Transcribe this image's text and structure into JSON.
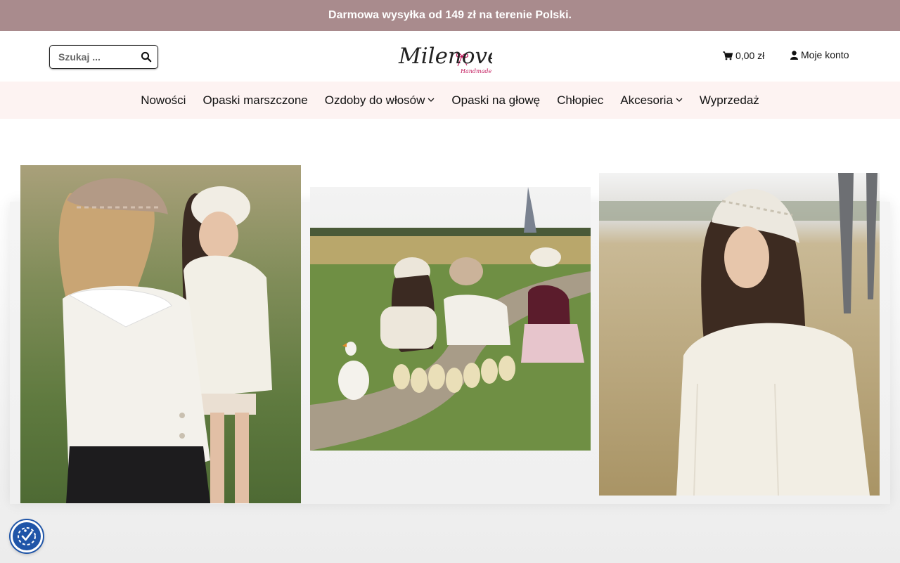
{
  "announcement": {
    "text": "Darmowa wysyłka od 149 zł na terenie Polski."
  },
  "header": {
    "search": {
      "placeholder": "Szukaj ...",
      "value": ""
    },
    "logo": {
      "name": "Milenove",
      "tagline": "Handmade"
    },
    "cart": {
      "amount": "0,00 zł",
      "icon": "cart-icon"
    },
    "account": {
      "label": "Moje konto",
      "icon": "user-icon"
    }
  },
  "nav": {
    "items": [
      {
        "label": "Nowości",
        "has_dropdown": false
      },
      {
        "label": "Opaski marszczone",
        "has_dropdown": false
      },
      {
        "label": "Ozdoby do włosów",
        "has_dropdown": true
      },
      {
        "label": "Opaski na głowę",
        "has_dropdown": false
      },
      {
        "label": "Chłopiec",
        "has_dropdown": false
      },
      {
        "label": "Akcesoria",
        "has_dropdown": true
      },
      {
        "label": "Wyprzedaż",
        "has_dropdown": false
      }
    ]
  },
  "hero": {
    "photos": [
      {
        "name": "two-girls-crochet-bandana-field"
      },
      {
        "name": "children-with-ducklings-field"
      },
      {
        "name": "girl-crochet-bandana-wheat-field"
      }
    ]
  },
  "accessibility": {
    "icon": "accessibility-icon"
  },
  "colors": {
    "announcement_bg": "#a98b8d",
    "nav_bg": "#fdf3f2",
    "logo_accent": "#c2185b",
    "access_button": "#1f55a8"
  }
}
